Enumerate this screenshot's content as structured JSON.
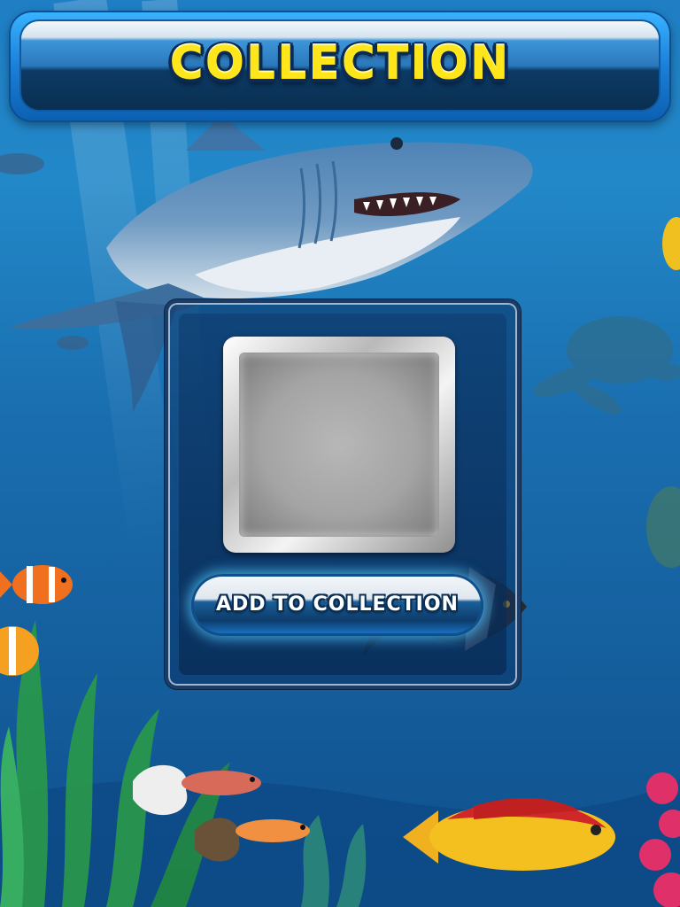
{
  "header": {
    "title": "COLLECTION"
  },
  "collection_panel": {
    "slot_image": "empty-item-slot",
    "add_button_label": "ADD TO COLLECTION"
  },
  "background": {
    "scene": "underwater-ocean",
    "creatures": [
      "shark-icon",
      "sea-turtle-icon",
      "clownfish-icon",
      "guppy-icon",
      "angelfish-icon",
      "wrasse-fish-icon",
      "seaweed-icon"
    ]
  },
  "colors": {
    "title_text": "#ffe61a",
    "header_blue": "#1b7fd8",
    "ocean": "#1a6fb0",
    "button_glow": "#50c8ff"
  }
}
